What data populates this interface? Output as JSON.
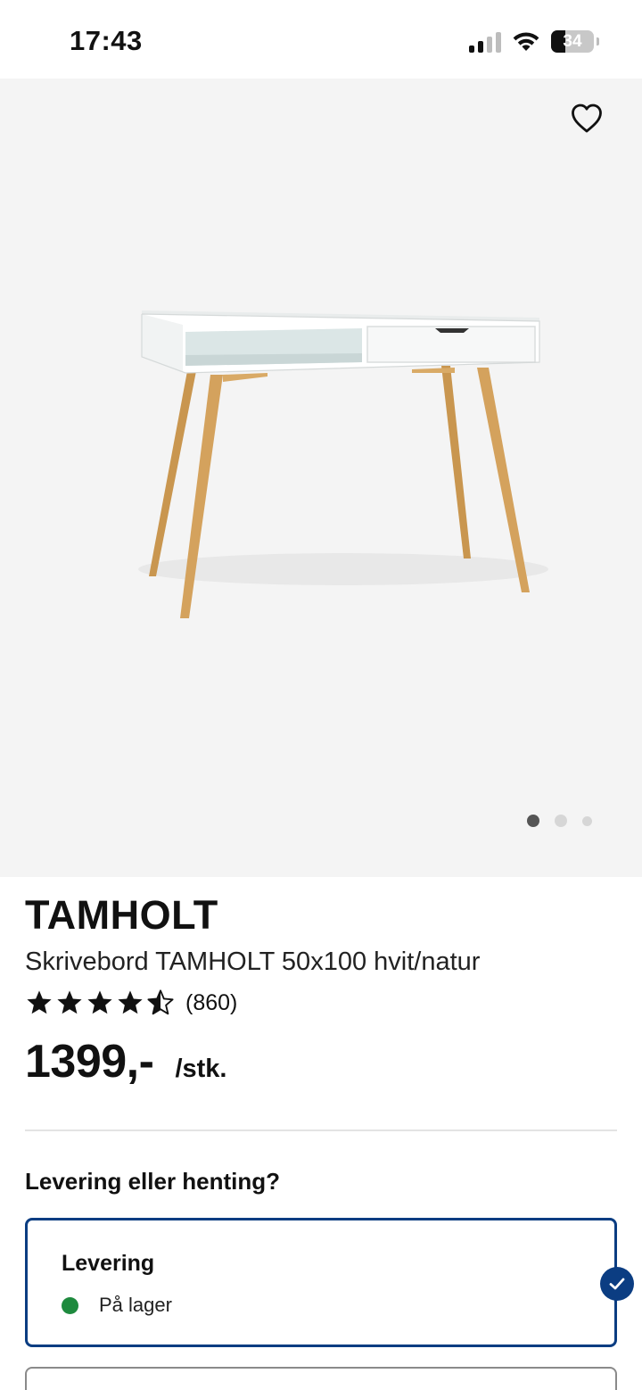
{
  "status_bar": {
    "time": "17:43",
    "battery": "34",
    "battery_level": 0.34,
    "icons": [
      "cellular-signal-icon",
      "wifi-icon",
      "battery-icon"
    ]
  },
  "hero": {
    "favorite_icon": "heart-outline-icon",
    "image_subject": "product-photo",
    "carousel_count": 3,
    "carousel_active": 1
  },
  "product": {
    "brand": "TAMHOLT",
    "name": "Skrivebord TAMHOLT 50x100 hvit/natur",
    "rating": 4.5,
    "rating_count": "(860)",
    "price": "1399,-",
    "unit": "/stk."
  },
  "delivery": {
    "heading": "Levering eller henting?",
    "options": [
      {
        "title": "Levering",
        "status": "På lager",
        "status_color": "#1e8a3e",
        "selected": true
      }
    ]
  },
  "colors": {
    "accent": "#0b3d82",
    "hero_bg": "#f4f4f4"
  }
}
